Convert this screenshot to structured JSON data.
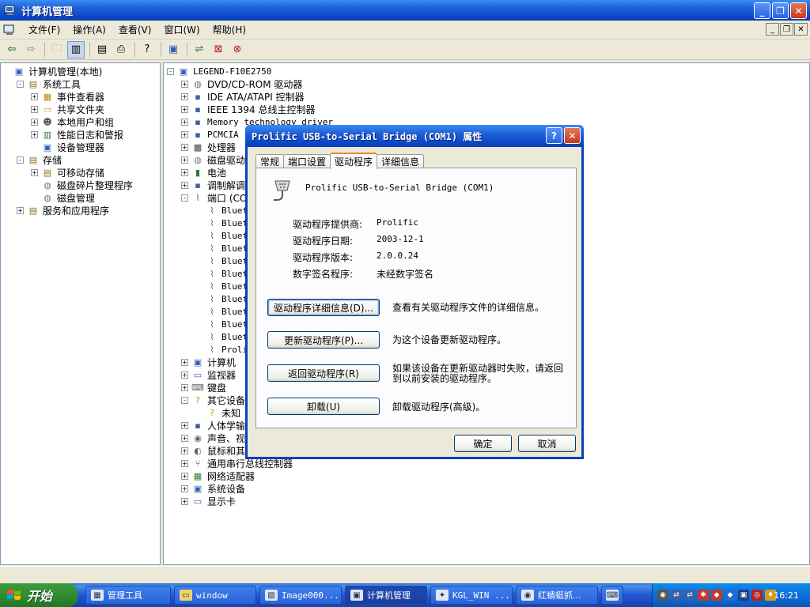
{
  "window": {
    "title": "计算机管理"
  },
  "menu": [
    "文件(F)",
    "操作(A)",
    "查看(V)",
    "窗口(W)",
    "帮助(H)"
  ],
  "left_tree": [
    {
      "label": "计算机管理(本地)",
      "level": 0,
      "expander": ""
    },
    {
      "label": "系统工具",
      "level": 1,
      "expander": "-"
    },
    {
      "label": "事件查看器",
      "level": 2,
      "expander": "+"
    },
    {
      "label": "共享文件夹",
      "level": 2,
      "expander": "+"
    },
    {
      "label": "本地用户和组",
      "level": 2,
      "expander": "+"
    },
    {
      "label": "性能日志和警报",
      "level": 2,
      "expander": "+"
    },
    {
      "label": "设备管理器",
      "level": 2,
      "expander": ""
    },
    {
      "label": "存储",
      "level": 1,
      "expander": "-"
    },
    {
      "label": "可移动存储",
      "level": 2,
      "expander": "+"
    },
    {
      "label": "磁盘碎片整理程序",
      "level": 2,
      "expander": ""
    },
    {
      "label": "磁盘管理",
      "level": 2,
      "expander": ""
    },
    {
      "label": "服务和应用程序",
      "level": 1,
      "expander": "+"
    }
  ],
  "right_tree": [
    {
      "label": "LEGEND-F10E2750",
      "level": 0,
      "expander": "-",
      "mono": true
    },
    {
      "label": "DVD/CD-ROM 驱动器",
      "level": 1,
      "expander": "+"
    },
    {
      "label": "IDE ATA/ATAPI 控制器",
      "level": 1,
      "expander": "+"
    },
    {
      "label": "IEEE 1394 总线主控制器",
      "level": 1,
      "expander": "+"
    },
    {
      "label": "Memory technology driver",
      "level": 1,
      "expander": "+",
      "mono": true
    },
    {
      "label": "PCMCIA",
      "level": 1,
      "expander": "+",
      "mono": true
    },
    {
      "label": "处理器",
      "level": 1,
      "expander": "+"
    },
    {
      "label": "磁盘驱动",
      "level": 1,
      "expander": "+"
    },
    {
      "label": "电池",
      "level": 1,
      "expander": "+"
    },
    {
      "label": "调制解调",
      "level": 1,
      "expander": "+"
    },
    {
      "label": "端口 (CO",
      "level": 1,
      "expander": "-"
    },
    {
      "label": "Bluet",
      "level": 2,
      "expander": "",
      "mono": true
    },
    {
      "label": "Bluet",
      "level": 2,
      "expander": "",
      "mono": true
    },
    {
      "label": "Bluet",
      "level": 2,
      "expander": "",
      "mono": true
    },
    {
      "label": "Bluet",
      "level": 2,
      "expander": "",
      "mono": true
    },
    {
      "label": "Bluet",
      "level": 2,
      "expander": "",
      "mono": true
    },
    {
      "label": "Bluet",
      "level": 2,
      "expander": "",
      "mono": true
    },
    {
      "label": "Bluet",
      "level": 2,
      "expander": "",
      "mono": true
    },
    {
      "label": "Bluet",
      "level": 2,
      "expander": "",
      "mono": true
    },
    {
      "label": "Bluet",
      "level": 2,
      "expander": "",
      "mono": true
    },
    {
      "label": "Bluet",
      "level": 2,
      "expander": "",
      "mono": true
    },
    {
      "label": "Bluet",
      "level": 2,
      "expander": "",
      "mono": true
    },
    {
      "label": "Proli",
      "level": 2,
      "expander": "",
      "mono": true
    },
    {
      "label": "计算机",
      "level": 1,
      "expander": "+"
    },
    {
      "label": "监视器",
      "level": 1,
      "expander": "+"
    },
    {
      "label": "键盘",
      "level": 1,
      "expander": "+"
    },
    {
      "label": "其它设备",
      "level": 1,
      "expander": "-"
    },
    {
      "label": "未知",
      "level": 2,
      "expander": ""
    },
    {
      "label": "人体学输",
      "level": 1,
      "expander": "+"
    },
    {
      "label": "声音、视",
      "level": 1,
      "expander": "+"
    },
    {
      "label": "鼠标和其",
      "level": 1,
      "expander": "+"
    },
    {
      "label": "通用串行总线控制器",
      "level": 1,
      "expander": "+"
    },
    {
      "label": "网络适配器",
      "level": 1,
      "expander": "+"
    },
    {
      "label": "系统设备",
      "level": 1,
      "expander": "+"
    },
    {
      "label": "显示卡",
      "level": 1,
      "expander": "+"
    }
  ],
  "dialog": {
    "title": "Prolific USB-to-Serial Bridge (COM1) 属性",
    "tabs": [
      "常规",
      "端口设置",
      "驱动程序",
      "详细信息"
    ],
    "active_tab": "驱动程序",
    "device_name": "Prolific USB-to-Serial Bridge (COM1)",
    "info": [
      {
        "label": "驱动程序提供商:",
        "value": "Prolific"
      },
      {
        "label": "驱动程序日期:",
        "value": "2003-12-1"
      },
      {
        "label": "驱动程序版本:",
        "value": "2.0.0.24"
      },
      {
        "label": "数字签名程序:",
        "value": "未经数字签名"
      }
    ],
    "actions": [
      {
        "button": "驱动程序详细信息(D)...",
        "desc": "查看有关驱动程序文件的详细信息。"
      },
      {
        "button": "更新驱动程序(P)...",
        "desc": "为这个设备更新驱动程序。"
      },
      {
        "button": "返回驱动程序(R)",
        "desc": "如果该设备在更新驱动器时失败，请返回到以前安装的驱动程序。"
      },
      {
        "button": "卸载(U)",
        "desc": "卸载驱动程序(高级)。"
      }
    ],
    "ok": "确定",
    "cancel": "取消"
  },
  "taskbar": {
    "start": "开始",
    "items": [
      "管理工具",
      "window",
      "Image000...",
      "计算机管理",
      "KGL_WIN ...",
      "红蜻蜓抓..."
    ],
    "clock": "16:21"
  }
}
